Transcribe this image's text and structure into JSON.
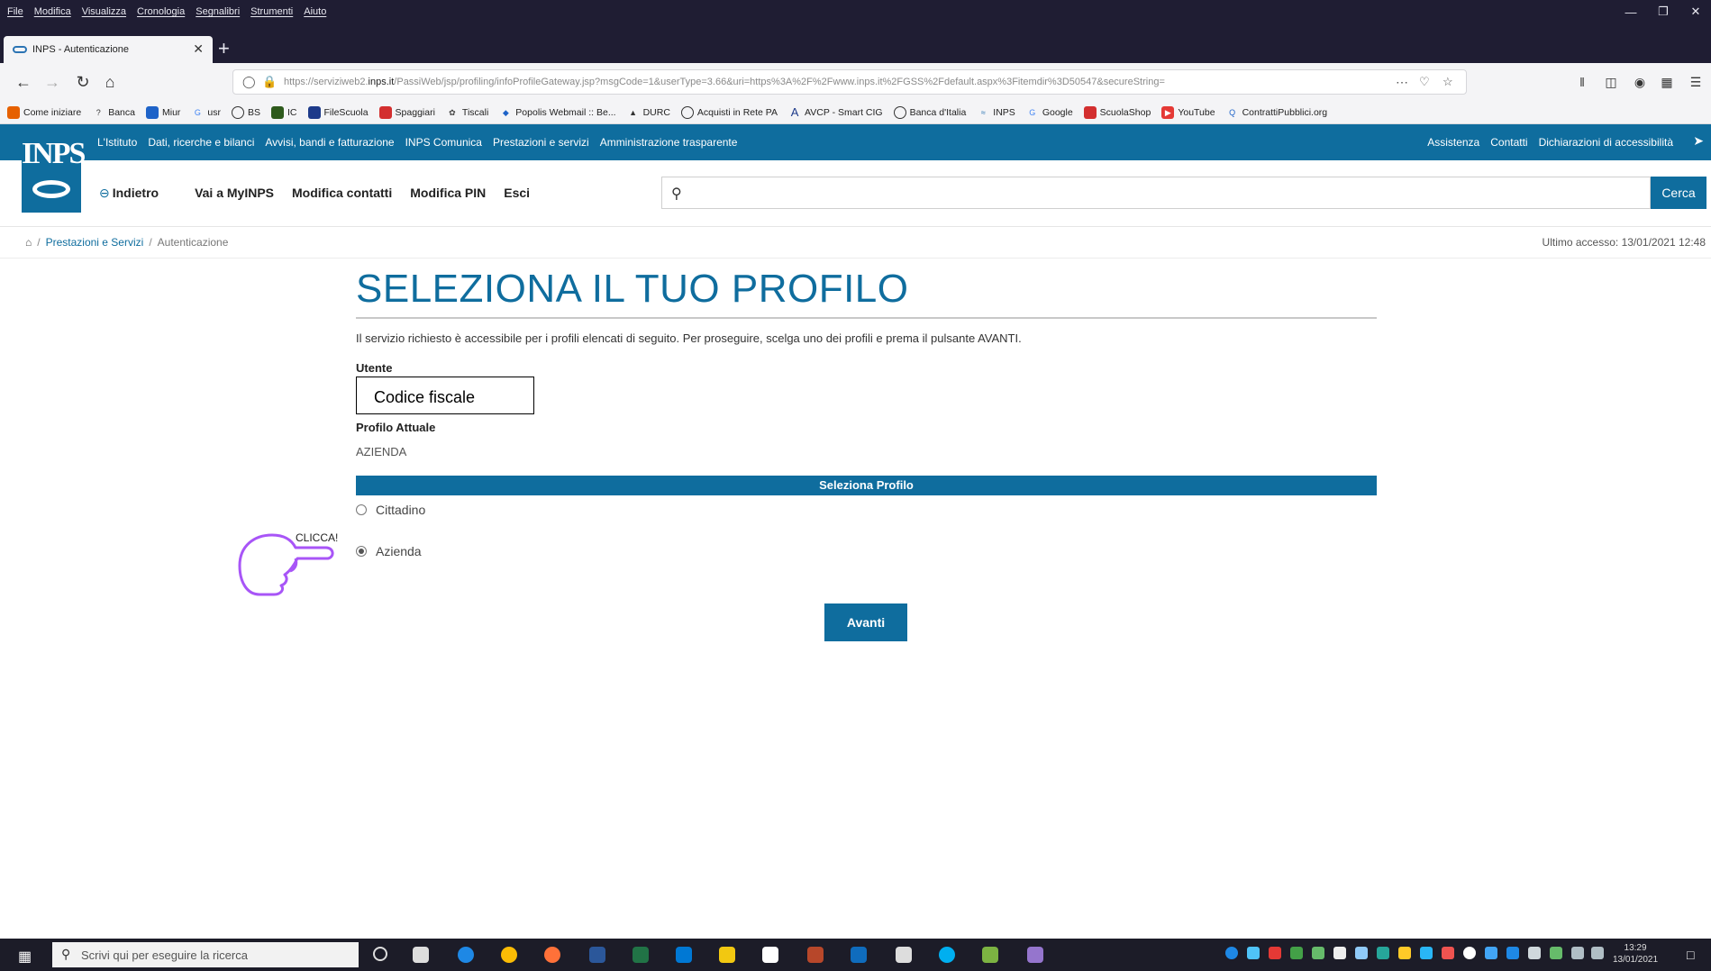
{
  "browser": {
    "menu": [
      "File",
      "Modifica",
      "Visualizza",
      "Cronologia",
      "Segnalibri",
      "Strumenti",
      "Aiuto"
    ],
    "tab_title": "INPS - Autenticazione",
    "url_prefix": "https://serviziweb2.",
    "url_domain": "inps.it",
    "url_rest": "/PassiWeb/jsp/profiling/infoProfileGateway.jsp?msgCode=1&userType=3.66&uri=https%3A%2F%2Fwww.inps.it%2FGSS%2Fdefault.aspx%3Fitemdir%3D50547&secureString=",
    "bookmarks": [
      "Come iniziare",
      "Banca",
      "Miur",
      "usr",
      "BS",
      "IC",
      "FileScuola",
      "Spaggiari",
      "Tiscali",
      "Popolis Webmail :: Be...",
      "DURC",
      "Acquisti in Rete PA",
      "AVCP - Smart CIG",
      "Banca d'Italia",
      "INPS",
      "Google",
      "ScuolaShop",
      "YouTube",
      "ContrattiPubblici.org"
    ]
  },
  "inps": {
    "logo_text": "INPS",
    "top_links": [
      "L'Istituto",
      "Dati, ricerche e bilanci",
      "Avvisi, bandi e fatturazione",
      "INPS Comunica",
      "Prestazioni e servizi",
      "Amministrazione trasparente"
    ],
    "top_right_links": [
      "Assistenza",
      "Contatti",
      "Dichiarazioni di accessibilità"
    ],
    "back_label": "Indietro",
    "sub_links": [
      "Vai a MyINPS",
      "Modifica contatti",
      "Modifica PIN",
      "Esci"
    ],
    "search_placeholder": "",
    "search_button": "Cerca",
    "breadcrumb": [
      "Prestazioni e Servizi",
      "Autenticazione"
    ],
    "last_access": "Ultimo accesso: 13/01/2021 12:48"
  },
  "content": {
    "title": "SELEZIONA IL TUO PROFILO",
    "intro": "Il servizio richiesto è accessibile per i profili elencati di seguito. Per proseguire, scelga uno dei profili e prema il pulsante AVANTI.",
    "user_label": "Utente",
    "user_value": "Codice fiscale",
    "current_profile_label": "Profilo Attuale",
    "current_profile_value": "AZIENDA",
    "select_header": "Seleziona Profilo",
    "options": [
      {
        "label": "Cittadino",
        "selected": false
      },
      {
        "label": "Azienda",
        "selected": true
      }
    ],
    "annotation": "CLICCA!",
    "submit": "Avanti"
  },
  "taskbar": {
    "search_placeholder": "Scrivi qui per eseguire la ricerca",
    "time": "13:29",
    "date": "13/01/2021"
  },
  "colors": {
    "inps_blue": "#0f6d9e",
    "annotation_purple": "#a855f7"
  }
}
